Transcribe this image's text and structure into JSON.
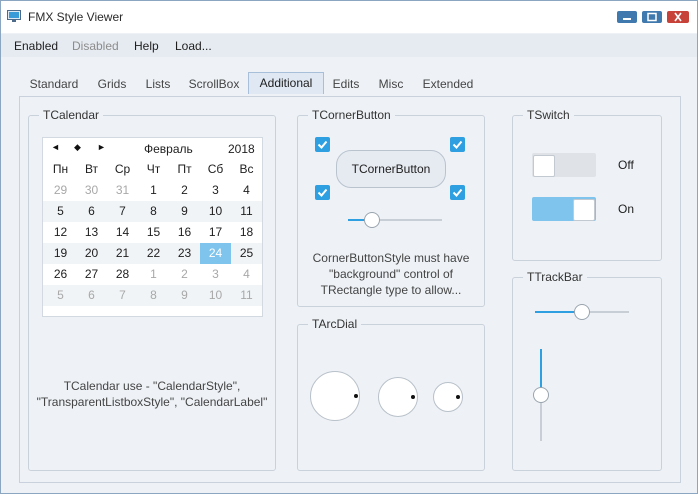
{
  "window": {
    "title": "FMX Style Viewer",
    "app_icon": "monitor-icon"
  },
  "window_controls": {
    "minimize_icon": "minimize-icon",
    "maximize_icon": "maximize-icon",
    "close_icon": "close-icon"
  },
  "menu": {
    "items": [
      {
        "label": "Enabled",
        "disabled": false
      },
      {
        "label": "Disabled",
        "disabled": true
      },
      {
        "label": "Help",
        "disabled": false
      },
      {
        "label": "Load...",
        "disabled": false
      }
    ]
  },
  "tabs": {
    "items": [
      "Standard",
      "Grids",
      "Lists",
      "ScrollBox",
      "Additional",
      "Edits",
      "Misc",
      "Extended"
    ],
    "active": "Additional"
  },
  "calendar": {
    "group_title": "TCalendar",
    "nav": {
      "prev": "◄",
      "today": "◆",
      "next": "►"
    },
    "month": "Февраль",
    "year": "2018",
    "weekdays": [
      "Пн",
      "Вт",
      "Ср",
      "Чт",
      "Пт",
      "Сб",
      "Вс"
    ],
    "weeks": [
      [
        "29",
        "30",
        "31",
        "1",
        "2",
        "3",
        "4"
      ],
      [
        "5",
        "6",
        "7",
        "8",
        "9",
        "10",
        "11"
      ],
      [
        "12",
        "13",
        "14",
        "15",
        "16",
        "17",
        "18"
      ],
      [
        "19",
        "20",
        "21",
        "22",
        "23",
        "24",
        "25"
      ],
      [
        "26",
        "27",
        "28",
        "1",
        "2",
        "3",
        "4"
      ],
      [
        "5",
        "6",
        "7",
        "8",
        "9",
        "10",
        "11"
      ]
    ],
    "selected": "24",
    "caption_line1": "TCalendar use - \"CalendarStyle\",",
    "caption_line2": "\"TransparentListboxStyle\", \"CalendarLabel\""
  },
  "corner_button": {
    "group_title": "TCornerButton",
    "button_label": "TCornerButton",
    "checkboxes_checked": [
      true,
      true,
      true,
      true
    ],
    "slider_value": 0.2,
    "caption_line1": "CornerButtonStyle must have",
    "caption_line2": "\"background\" control of",
    "caption_line3": "TRectangle type to allow..."
  },
  "switch": {
    "group_title": "TSwitch",
    "items": [
      {
        "label": "Off",
        "on": false
      },
      {
        "label": "On",
        "on": true
      }
    ],
    "color_on": "#7fc4ec",
    "color_off": "#dfe3e8"
  },
  "arc_dial": {
    "group_title": "TArcDial"
  },
  "trackbar": {
    "group_title": "TTrackBar",
    "horizontal_value": 0.5,
    "vertical_value": 0.5
  },
  "colors": {
    "accent": "#2e9fe0",
    "selection": "#7fc4ec",
    "close": "#c7433a",
    "window_button": "#3f79ad"
  }
}
